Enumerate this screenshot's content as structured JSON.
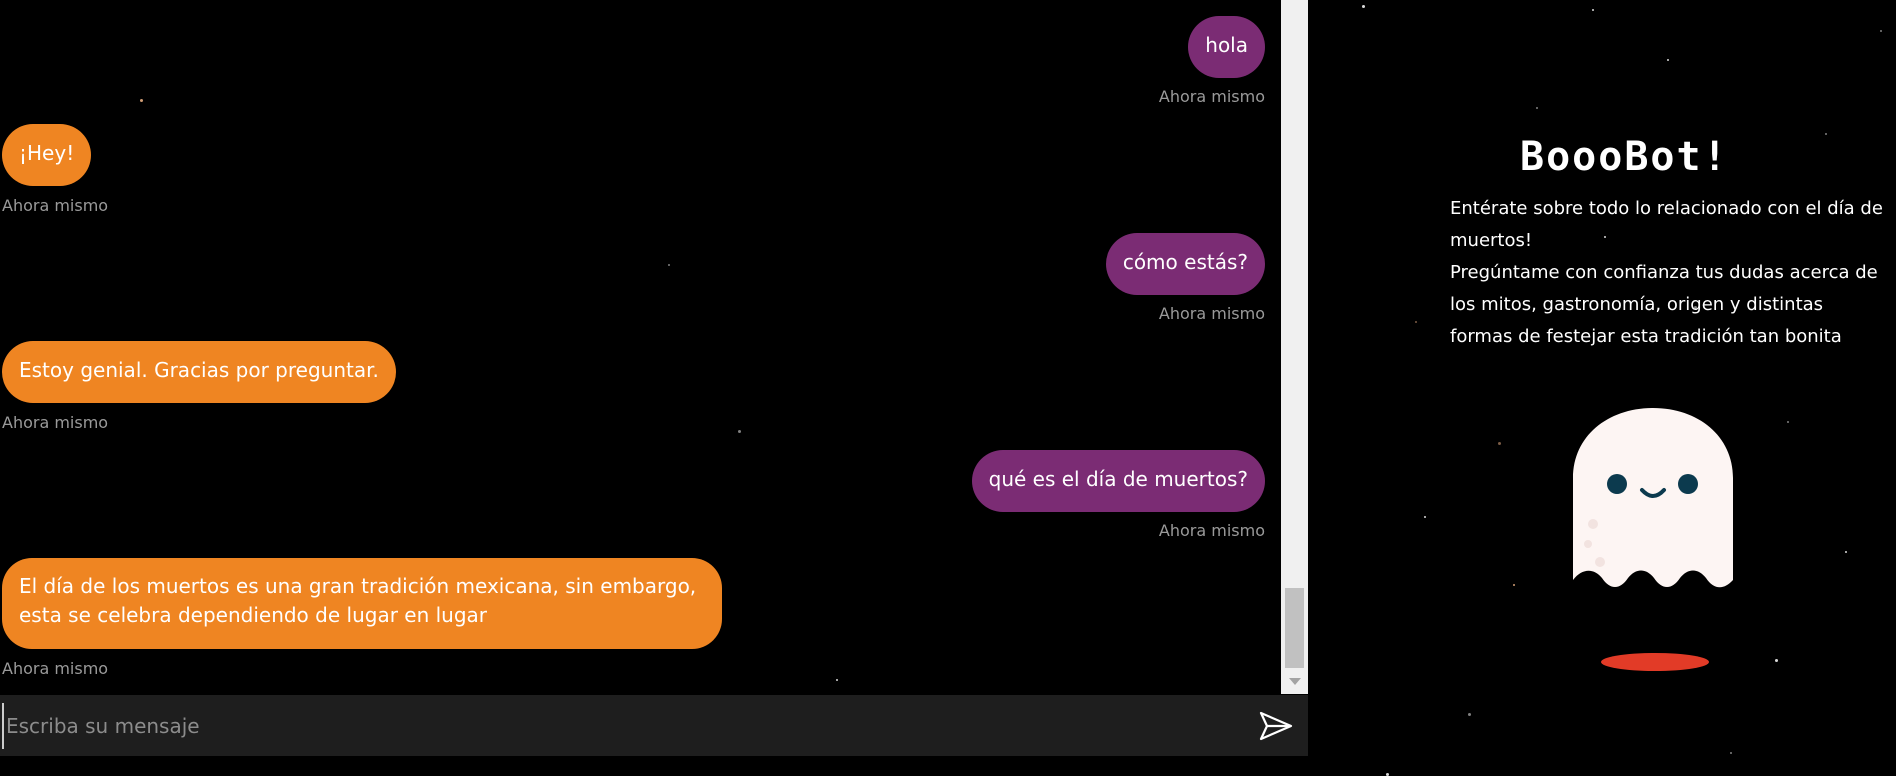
{
  "chat": {
    "messages": [
      {
        "sender": "user",
        "text": "hola",
        "time": "Ahora mismo"
      },
      {
        "sender": "bot",
        "text": "¡Hey!",
        "time": "Ahora mismo"
      },
      {
        "sender": "user",
        "text": "cómo estás?",
        "time": "Ahora mismo"
      },
      {
        "sender": "bot",
        "text": "Estoy genial. Gracias por preguntar.",
        "time": "Ahora mismo"
      },
      {
        "sender": "user",
        "text": "qué es el día de muertos?",
        "time": "Ahora mismo"
      },
      {
        "sender": "bot",
        "text": "El día de los muertos es una gran tradición mexicana, sin embargo, esta se celebra dependiendo de lugar en lugar",
        "time": "Ahora mismo"
      }
    ]
  },
  "input": {
    "placeholder": "Escriba su mensaje",
    "send_icon": "send-arrow-icon"
  },
  "panel": {
    "title": "BoooBot!",
    "line1": "Entérate sobre todo lo relacionado con el día de muertos!",
    "line2": "Pregúntame con confianza tus dudas acerca de los mitos, gastronomía, origen y distintas formas de festejar esta tradición tan bonita",
    "mascot": "ghost-icon"
  },
  "colors": {
    "background": "#000000",
    "user_bubble": "#7b2c74",
    "bot_bubble": "#ef8522",
    "timestamp": "#9a9a9a",
    "ghost_body": "#fdf5f3",
    "ghost_shadow": "#e23b27"
  }
}
